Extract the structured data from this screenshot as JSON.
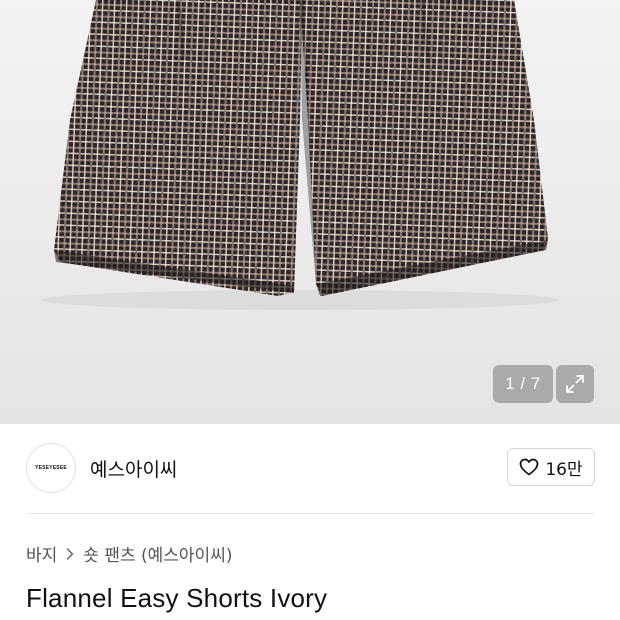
{
  "gallery": {
    "counter_text": "1 / 7",
    "image_icon": "plaid-shorts-photo",
    "expand_icon": "expand-icon",
    "current_slide": 1,
    "total_slides": 7
  },
  "brand": {
    "logo_text": "YESEYESEE",
    "name": "예스아이씨",
    "like_count": "16만",
    "like_icon": "heart-icon"
  },
  "breadcrumb": {
    "category": "바지",
    "separator_icon": "chevron-right-icon",
    "subcategory": "숏 팬츠 (예스아이씨)"
  },
  "product": {
    "title": "Flannel Easy Shorts Ivory"
  },
  "colors": {
    "gallery_bg": "#ededed",
    "plaid_dark": "#2b2328",
    "plaid_light": "#c9b7a8",
    "divider": "#e8e8e8"
  }
}
